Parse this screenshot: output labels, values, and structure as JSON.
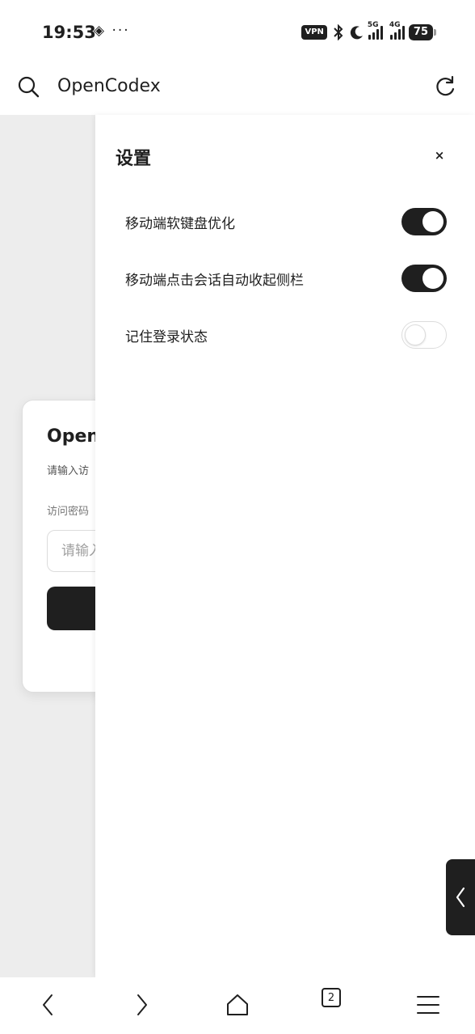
{
  "status_bar": {
    "time": "19:53",
    "left_icons": "◈ ···",
    "vpn": "VPN",
    "network_5g": "5G",
    "network_4g": "4G",
    "battery": "75"
  },
  "browser": {
    "title": "OpenCodex",
    "tab_count": "2"
  },
  "login": {
    "title": "Open",
    "subtitle": "请输入访",
    "password_label": "访问密码",
    "password_placeholder": "请输入"
  },
  "settings": {
    "title": "设置",
    "close": "×",
    "items": [
      {
        "label": "移动端软键盘优化",
        "enabled": true
      },
      {
        "label": "移动端点击会话自动收起侧栏",
        "enabled": true
      },
      {
        "label": "记住登录状态",
        "enabled": false
      }
    ]
  },
  "colors": {
    "accent": "#1f1f1f",
    "page_background": "#ededed",
    "surface": "#ffffff"
  }
}
